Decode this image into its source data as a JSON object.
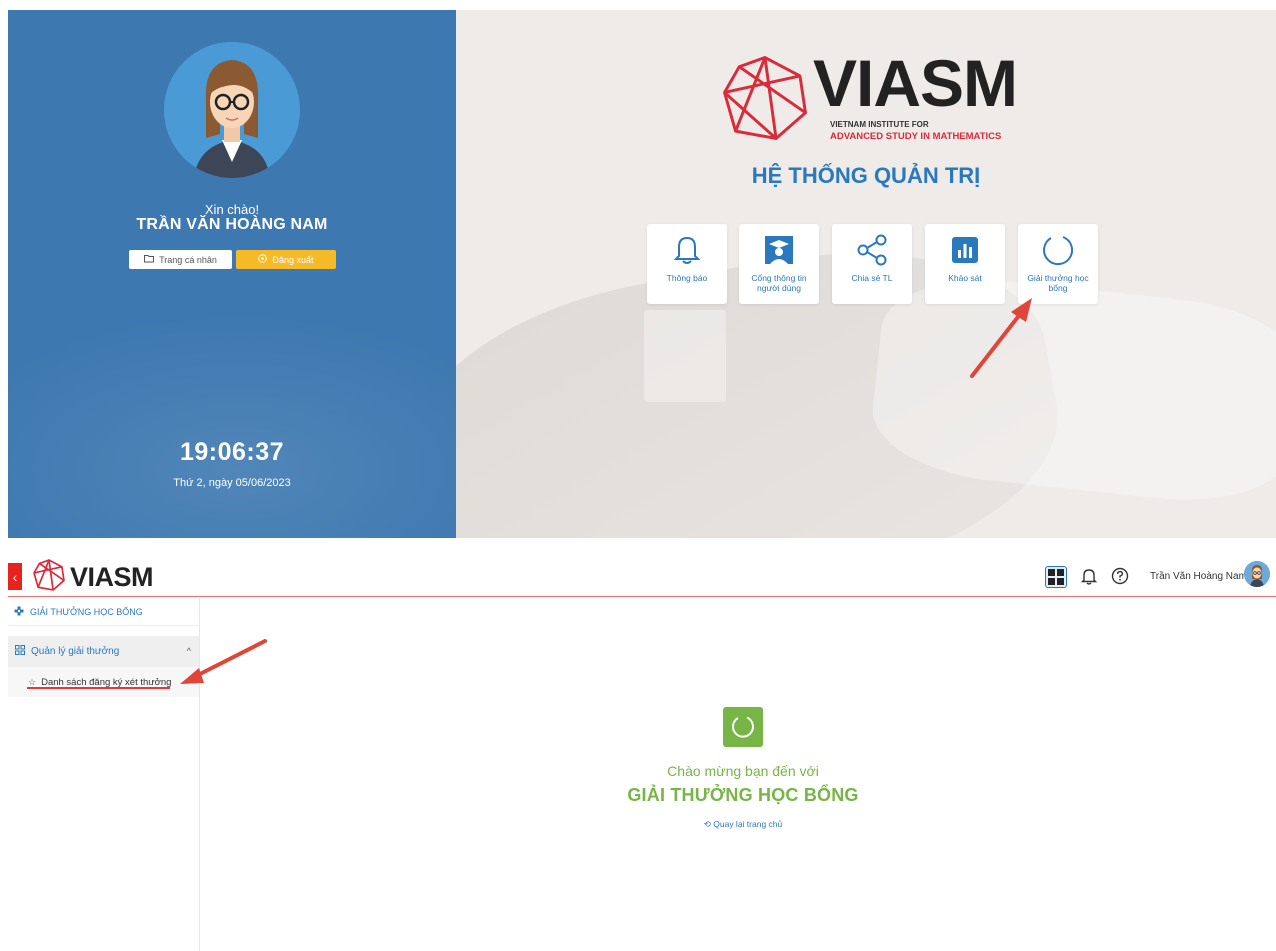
{
  "dashboard": {
    "greeting": "Xin chào!",
    "user_name": "TRẦN VĂN HOÀNG NAM",
    "profile_button": "Trang cá nhân",
    "logout_button": "Đăng xuất",
    "clock": "19:06:37",
    "date": "Thứ 2, ngày 05/06/2023",
    "logo_text": "VIASM",
    "logo_sub1": "VIETNAM INSTITUTE FOR",
    "logo_sub2": "ADVANCED STUDY IN MATHEMATICS",
    "system_title": "HỆ THỐNG QUẢN TRỊ",
    "tiles": [
      {
        "label": "Thông báo",
        "icon": "bell-icon"
      },
      {
        "label": "Cổng thông tin người dùng",
        "icon": "graduate-icon"
      },
      {
        "label": "Chia sẻ TL",
        "icon": "share-icon"
      },
      {
        "label": "Khảo sát",
        "icon": "chart-icon"
      },
      {
        "label": "Giải thưởng học bổng",
        "icon": "loading-circle-icon"
      }
    ]
  },
  "app": {
    "brand": "VIASM",
    "user_name": "Trần Văn Hoàng Nam",
    "sidebar": {
      "title": "GIẢI THƯỞNG HỌC BỔNG",
      "group_label": "Quản lý giải thưởng",
      "item_label": "Danh sách đăng ký xét thưởng"
    },
    "main": {
      "welcome": "Chào mừng bạn đến với",
      "title": "GIẢI THƯỞNG HỌC BỔNG",
      "home_link": "Quay lại trang chủ"
    }
  },
  "colors": {
    "primary_blue": "#2a78be",
    "left_panel": "#3d78b0",
    "logout_yellow": "#f6b927",
    "accent_red": "#e8221c",
    "green": "#76b546"
  }
}
